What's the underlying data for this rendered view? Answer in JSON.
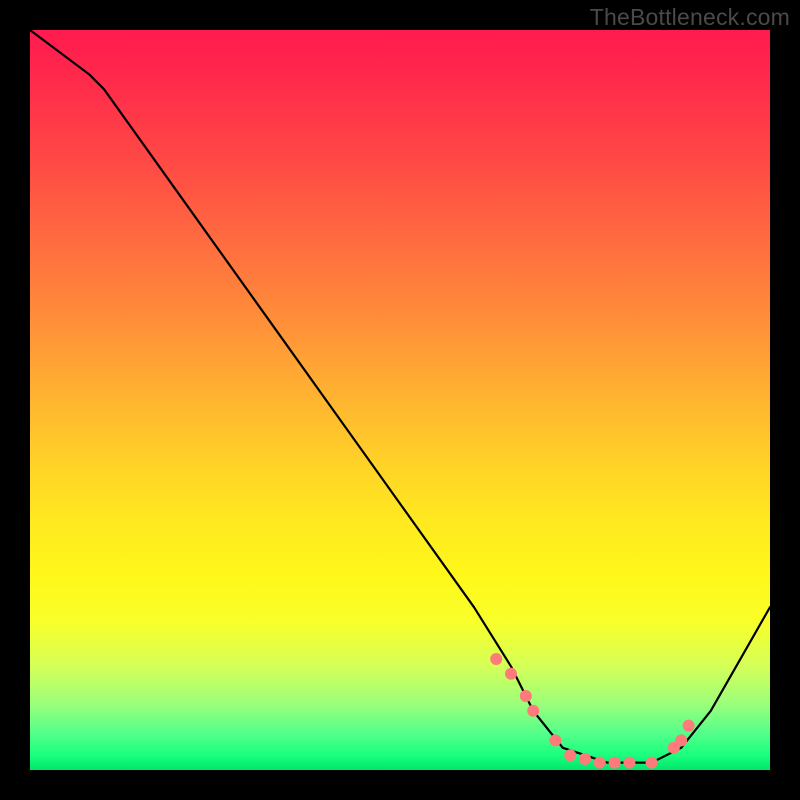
{
  "watermark": "TheBottleneck.com",
  "chart_data": {
    "type": "line",
    "title": "",
    "xlabel": "",
    "ylabel": "",
    "xlim": [
      0,
      100
    ],
    "ylim": [
      0,
      100
    ],
    "series": [
      {
        "name": "curve",
        "x": [
          0,
          8,
          10,
          20,
          30,
          40,
          50,
          60,
          65,
          68,
          72,
          78,
          84,
          88,
          92,
          100
        ],
        "values": [
          100,
          94,
          92,
          78,
          64,
          50,
          36,
          22,
          14,
          8,
          3,
          1,
          1,
          3,
          8,
          22
        ]
      }
    ],
    "markers": {
      "name": "points",
      "color": "#ff7a7a",
      "x": [
        63,
        65,
        67,
        68,
        71,
        73,
        75,
        77,
        79,
        81,
        84,
        87,
        88,
        89
      ],
      "values": [
        15,
        13,
        10,
        8,
        4,
        2,
        1.5,
        1,
        1,
        1,
        1,
        3,
        4,
        6
      ]
    },
    "gradient_stops": [
      {
        "pos": 0,
        "color": "#ff1a4f"
      },
      {
        "pos": 8,
        "color": "#ff2d4a"
      },
      {
        "pos": 18,
        "color": "#ff4a45"
      },
      {
        "pos": 28,
        "color": "#ff6a40"
      },
      {
        "pos": 38,
        "color": "#ff8a3a"
      },
      {
        "pos": 48,
        "color": "#ffae32"
      },
      {
        "pos": 58,
        "color": "#ffd028"
      },
      {
        "pos": 66,
        "color": "#ffe820"
      },
      {
        "pos": 74,
        "color": "#fff81a"
      },
      {
        "pos": 80,
        "color": "#f8ff2a"
      },
      {
        "pos": 86,
        "color": "#d4ff58"
      },
      {
        "pos": 91,
        "color": "#9cff7a"
      },
      {
        "pos": 95,
        "color": "#54ff8a"
      },
      {
        "pos": 98,
        "color": "#1aff7e"
      },
      {
        "pos": 100,
        "color": "#00e56b"
      }
    ]
  }
}
